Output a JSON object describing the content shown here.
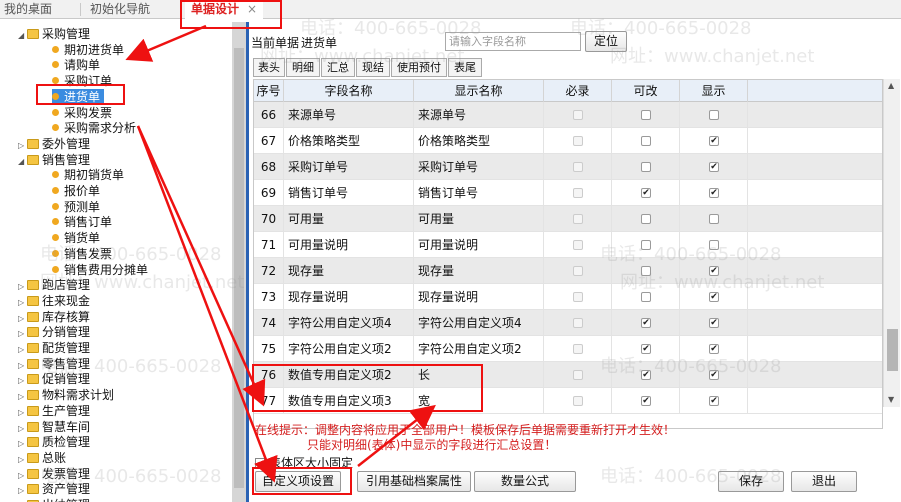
{
  "tabs": [
    {
      "label": "我的桌面"
    },
    {
      "label": "初始化导航"
    },
    {
      "label": "单据设计",
      "close": "×"
    }
  ],
  "tree": [
    {
      "label": "采购管理",
      "type": "folder",
      "expanded": true
    },
    {
      "label": "期初进货单",
      "type": "leaf"
    },
    {
      "label": "请购单",
      "type": "leaf"
    },
    {
      "label": "采购订单",
      "type": "leaf"
    },
    {
      "label": "进货单",
      "type": "leaf",
      "selected": true
    },
    {
      "label": "采购发票",
      "type": "leaf"
    },
    {
      "label": "采购需求分析",
      "type": "leaf"
    },
    {
      "label": "委外管理",
      "type": "folder",
      "expanded": false
    },
    {
      "label": "销售管理",
      "type": "folder",
      "expanded": true
    },
    {
      "label": "期初销货单",
      "type": "leaf"
    },
    {
      "label": "报价单",
      "type": "leaf"
    },
    {
      "label": "预测单",
      "type": "leaf"
    },
    {
      "label": "销售订单",
      "type": "leaf"
    },
    {
      "label": "销货单",
      "type": "leaf"
    },
    {
      "label": "销售发票",
      "type": "leaf"
    },
    {
      "label": "销售费用分摊单",
      "type": "leaf"
    },
    {
      "label": "跑店管理",
      "type": "folder"
    },
    {
      "label": "往来现金",
      "type": "folder"
    },
    {
      "label": "库存核算",
      "type": "folder"
    },
    {
      "label": "分销管理",
      "type": "folder"
    },
    {
      "label": "配货管理",
      "type": "folder"
    },
    {
      "label": "零售管理",
      "type": "folder"
    },
    {
      "label": "促销管理",
      "type": "folder"
    },
    {
      "label": "物料需求计划",
      "type": "folder"
    },
    {
      "label": "生产管理",
      "type": "folder"
    },
    {
      "label": "智慧车间",
      "type": "folder"
    },
    {
      "label": "质检管理",
      "type": "folder"
    },
    {
      "label": "总账",
      "type": "folder"
    },
    {
      "label": "发票管理",
      "type": "folder"
    },
    {
      "label": "资产管理",
      "type": "folder"
    },
    {
      "label": "出纳管理",
      "type": "folder"
    }
  ],
  "toolbar": {
    "current_label": "当前单据",
    "current_doc": "进货单",
    "field_placeholder": "请输入字段名称",
    "locate_label": "定位"
  },
  "subtabs": [
    "表头",
    "明细",
    "汇总",
    "现结",
    "使用预付",
    "表尾"
  ],
  "grid": {
    "headers": [
      "序号",
      "字段名称",
      "显示名称",
      "必录",
      "可改",
      "显示"
    ],
    "rows": [
      {
        "no": "66",
        "field": "来源单号",
        "display": "来源单号",
        "req": false,
        "edit": false,
        "show": false
      },
      {
        "no": "67",
        "field": "价格策略类型",
        "display": "价格策略类型",
        "req": false,
        "edit": false,
        "show": true
      },
      {
        "no": "68",
        "field": "采购订单号",
        "display": "采购订单号",
        "req": false,
        "edit": false,
        "show": true
      },
      {
        "no": "69",
        "field": "销售订单号",
        "display": "销售订单号",
        "req": false,
        "edit": true,
        "show": true
      },
      {
        "no": "70",
        "field": "可用量",
        "display": "可用量",
        "req": false,
        "edit": false,
        "show": false
      },
      {
        "no": "71",
        "field": "可用量说明",
        "display": "可用量说明",
        "req": false,
        "edit": false,
        "show": false
      },
      {
        "no": "72",
        "field": "现存量",
        "display": "现存量",
        "req": false,
        "edit": false,
        "show": true
      },
      {
        "no": "73",
        "field": "现存量说明",
        "display": "现存量说明",
        "req": false,
        "edit": false,
        "show": true
      },
      {
        "no": "74",
        "field": "字符公用自定义项4",
        "display": "字符公用自定义项4",
        "req": false,
        "edit": true,
        "show": true
      },
      {
        "no": "75",
        "field": "字符公用自定义项2",
        "display": "字符公用自定义项2",
        "req": false,
        "edit": true,
        "show": true
      },
      {
        "no": "76",
        "field": "数值专用自定义项2",
        "display": "长",
        "req": false,
        "edit": true,
        "show": true
      },
      {
        "no": "77",
        "field": "数值专用自定义项3",
        "display": "宽",
        "req": false,
        "edit": true,
        "show": true
      }
    ]
  },
  "tips": {
    "line1": "在线提示：调整内容将应用于全部用户！模板保存后单据需要重新打开才生效！",
    "line2": "只能对明细(表体)中显示的字段进行汇总设置！"
  },
  "fixed_label": "表体区大小固定",
  "buttons": {
    "custom": "自定义项设置",
    "ref": "引用基础档案属性",
    "qty": "数量公式",
    "save": "保存",
    "exit": "退出"
  },
  "watermark": {
    "phone": "电话：400-665-0028",
    "site": "网址：www.chanjet.net"
  },
  "colors": {
    "accent": "#e11111",
    "selected": "#3b8ce0",
    "header_bg": "#e8eff8"
  }
}
